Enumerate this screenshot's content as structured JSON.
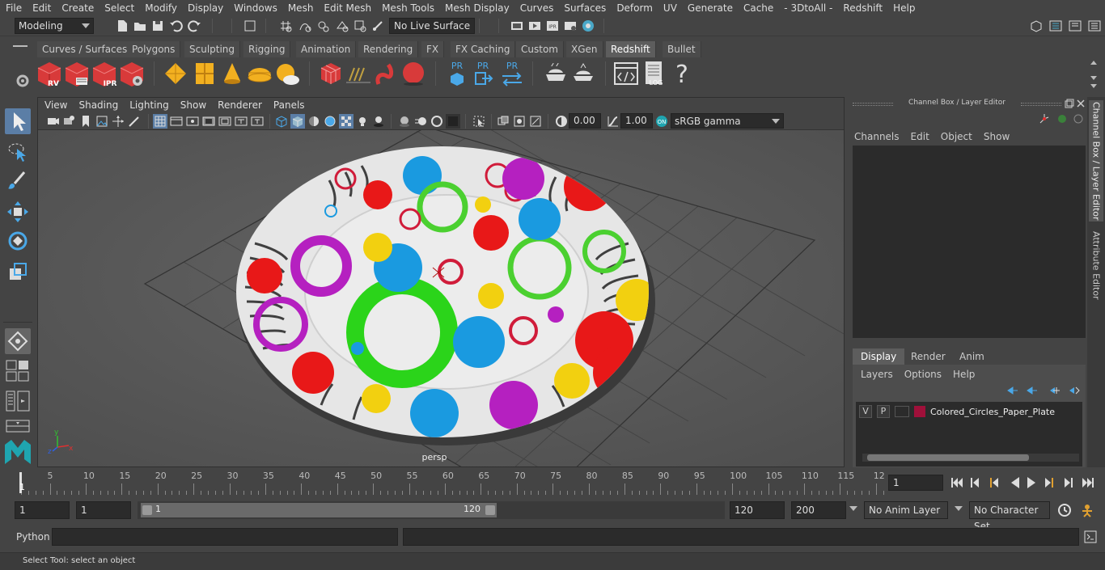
{
  "menubar": {
    "items": [
      "File",
      "Edit",
      "Create",
      "Select",
      "Modify",
      "Display",
      "Windows",
      "Mesh",
      "Edit Mesh",
      "Mesh Tools",
      "Mesh Display",
      "Curves",
      "Surfaces",
      "Deform",
      "UV",
      "Generate",
      "Cache",
      "- 3DtoAll -",
      "Redshift",
      "Help"
    ]
  },
  "statusline": {
    "mode": "Modeling",
    "live_surface": "No Live Surface"
  },
  "shelf": {
    "tabs": [
      "Curves / Surfaces",
      "Polygons",
      "Sculpting",
      "Rigging",
      "Animation",
      "Rendering",
      "FX",
      "FX Caching",
      "Custom",
      "XGen",
      "Redshift",
      "Bullet"
    ],
    "active_tab": "Redshift",
    "icon_labels": {
      "rv": "RV",
      "ipr": "IPR",
      "pr1": "PR",
      "pr2": "PR",
      "pr3": "PR",
      "log": "LOG",
      "help": "?"
    }
  },
  "viewport": {
    "menu": [
      "View",
      "Shading",
      "Lighting",
      "Show",
      "Renderer",
      "Panels"
    ],
    "exposure": "0.00",
    "gamma": "1.00",
    "color_space": "sRGB gamma",
    "camera_label": "persp",
    "axis": {
      "x": "x",
      "y": "y",
      "z": "z"
    }
  },
  "channelbox": {
    "title": "Channel Box / Layer Editor",
    "menu": [
      "Channels",
      "Edit",
      "Object",
      "Show"
    ],
    "tabs": [
      "Display",
      "Render",
      "Anim"
    ],
    "active_tab": "Display",
    "layer_menu": [
      "Layers",
      "Options",
      "Help"
    ],
    "layer": {
      "v": "V",
      "p": "P",
      "name": "Colored_Circles_Paper_Plate",
      "color": "#a0103a"
    }
  },
  "sidetabs": [
    "Channel Box / Layer Editor",
    "Attribute Editor"
  ],
  "timeline": {
    "ticks": [
      "5",
      "10",
      "15",
      "20",
      "25",
      "30",
      "35",
      "40",
      "45",
      "50",
      "55",
      "60",
      "65",
      "70",
      "75",
      "80",
      "85",
      "90",
      "95",
      "100",
      "105",
      "110",
      "115",
      "12"
    ],
    "start_marker": "1",
    "current_frame": "1"
  },
  "range": {
    "start": "1",
    "inner_start": "1",
    "slider_start": "1",
    "slider_end": "120",
    "end": "120",
    "max_end": "200",
    "anim_layer": "No Anim Layer",
    "character_set": "No Character Set"
  },
  "commandline": {
    "language": "Python"
  },
  "helpline": {
    "text": "Select Tool: select an object"
  }
}
